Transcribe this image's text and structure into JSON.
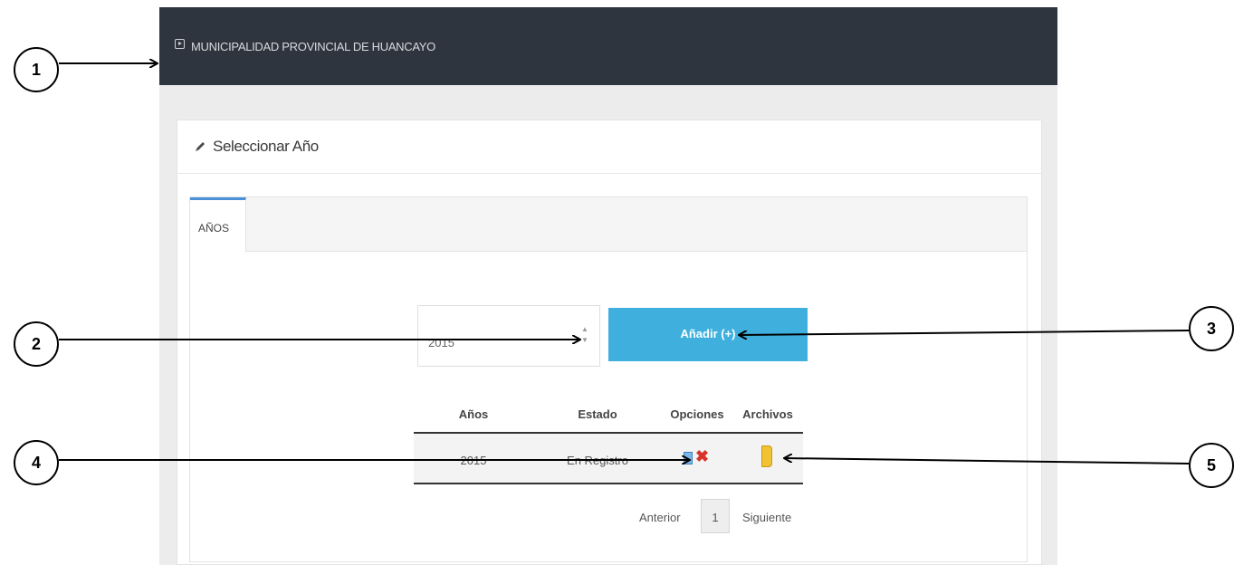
{
  "header": {
    "title": "MUNICIPALIDAD PROVINCIAL DE HUANCAYO"
  },
  "panel": {
    "title": "Seleccionar Año"
  },
  "tabs": [
    {
      "label": "AÑOS",
      "active": true
    }
  ],
  "year_select": {
    "value": "2015"
  },
  "add_button": {
    "label": "Añadir (+)"
  },
  "table": {
    "headers": [
      "Años",
      "Estado",
      "Opciones",
      "Archivos"
    ],
    "rows": [
      {
        "year": "2015",
        "status": "En Registro"
      }
    ]
  },
  "pagination": {
    "prev_label": "Anterior",
    "page": "1",
    "next_label": "Siguiente"
  },
  "callouts": [
    "1",
    "2",
    "3",
    "4",
    "5"
  ],
  "colors": {
    "topbar": "#2f353e",
    "accent_button": "#3fb0dd",
    "tab_accent": "#4a90d9",
    "delete_icon": "#d9342b",
    "folder_icon": "#f2c233"
  },
  "icons": [
    "play-square-icon",
    "pencil-icon",
    "spinner-arrows-icon",
    "edit-icon",
    "delete-icon",
    "folder-icon"
  ]
}
